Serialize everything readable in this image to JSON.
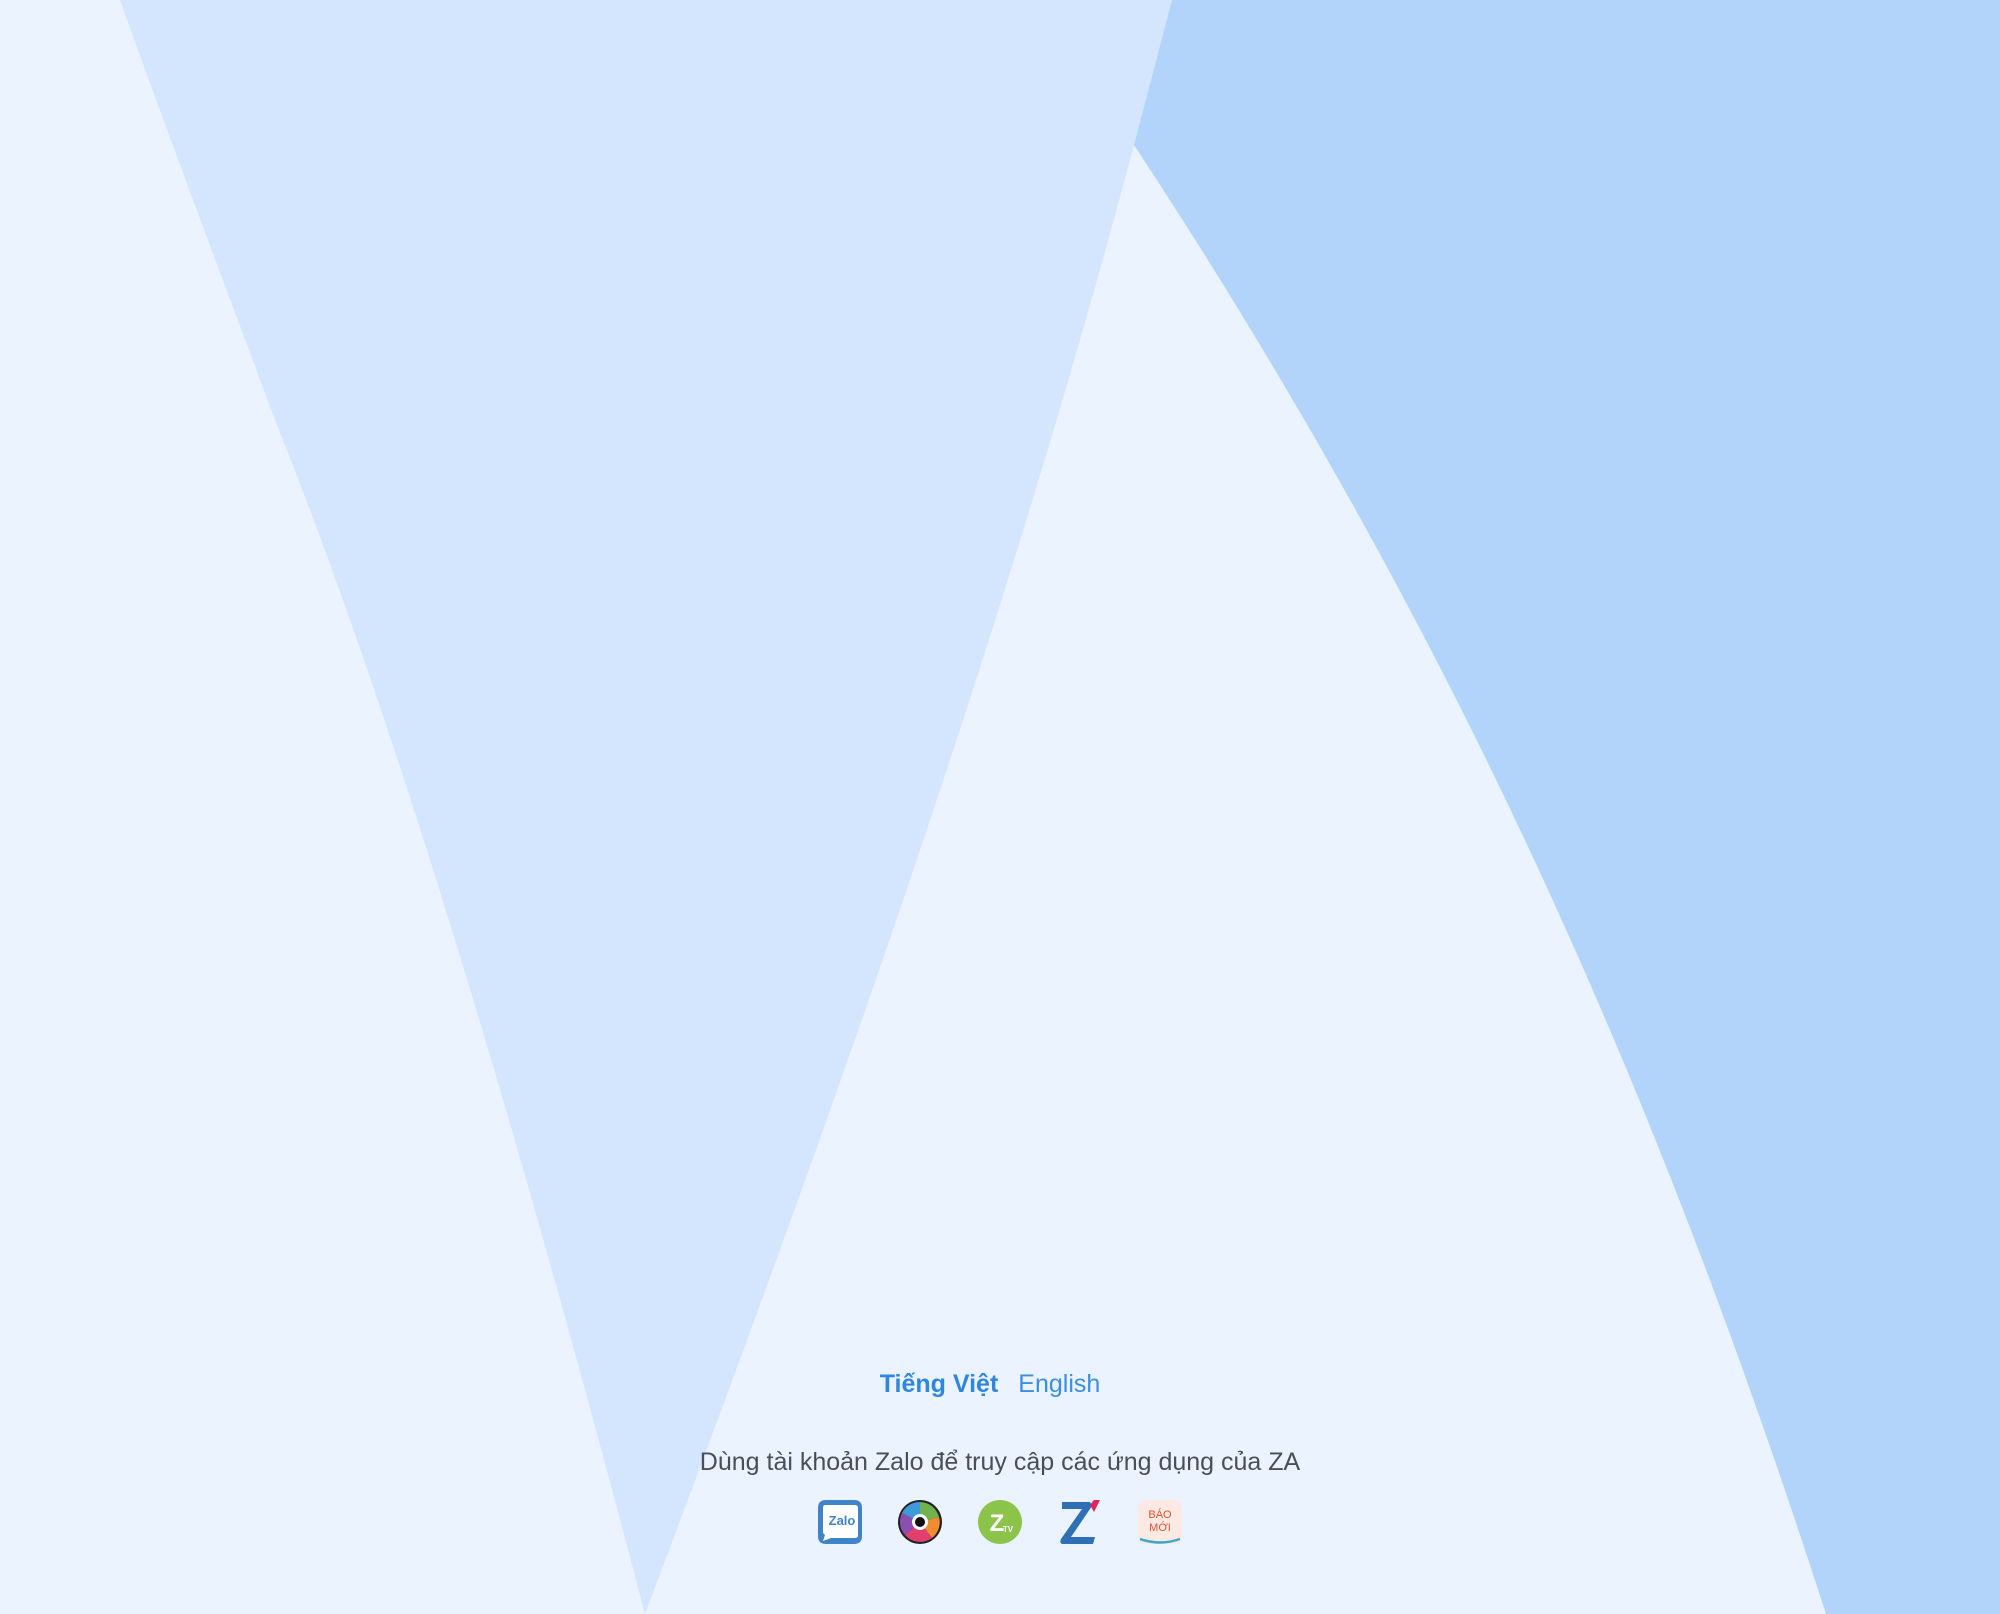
{
  "languages": [
    {
      "label": "Tiếng Việt",
      "active": true
    },
    {
      "label": "English",
      "active": false
    }
  ],
  "tagline": "Dùng tài khoản Zalo để truy cập các ứng dụng của ZA",
  "apps": [
    {
      "icon": "zalo-app-icon",
      "text": "Zalo"
    },
    {
      "icon": "camera-app-icon"
    },
    {
      "icon": "zing-tv-app-icon",
      "text": "Z",
      "subtext": "TV"
    },
    {
      "icon": "zing-app-icon",
      "text": "Z"
    },
    {
      "icon": "bao-moi-app-icon",
      "text_line1": "BÁO",
      "text_line2": "MỚI"
    }
  ],
  "colors": {
    "background": "#eaf3ff",
    "shape_light": "#d3e6fe",
    "shape_dark": "#b2d4fb",
    "accent": "#3a8ee6",
    "tagline": "#4a4f57"
  }
}
